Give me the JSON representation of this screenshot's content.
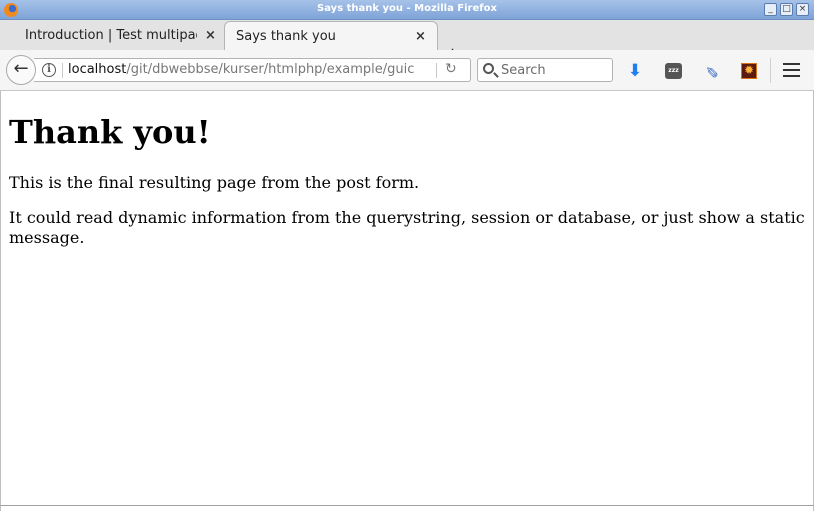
{
  "window": {
    "title": "Says thank you - Mozilla Firefox"
  },
  "tabs": [
    {
      "label": "Introduction | Test multipag",
      "active": false
    },
    {
      "label": "Says thank you",
      "active": true
    }
  ],
  "urlbar": {
    "host": "localhost",
    "path": "/git/dbwebbse/kurser/htmlphp/example/guic"
  },
  "search": {
    "placeholder": "Search"
  },
  "icons": {
    "app": "firefox-icon",
    "close_tab": "close-icon",
    "new_tab": "plus-icon",
    "back": "back-arrow-icon",
    "info": "info-icon",
    "reload": "reload-icon",
    "search": "search-icon",
    "download": "download-icon",
    "sleep": "sleep-icon",
    "eyedropper": "eyedropper-icon",
    "addon": "addon-gear-icon",
    "menu": "hamburger-menu-icon"
  },
  "glyphs": {
    "close": "×",
    "plus": "+",
    "back": "←",
    "info": "i",
    "reload": "↻",
    "download": "⬇",
    "sleep": "zzz",
    "dropper": "✎",
    "addon": "✹",
    "minimize": "_",
    "maximize": "□",
    "close_window": "×"
  },
  "page": {
    "heading": "Thank you!",
    "paragraph1": "This is the final resulting page from the post form.",
    "paragraph2": "It could read dynamic information from the querystring, session or database, or just show a static message."
  }
}
